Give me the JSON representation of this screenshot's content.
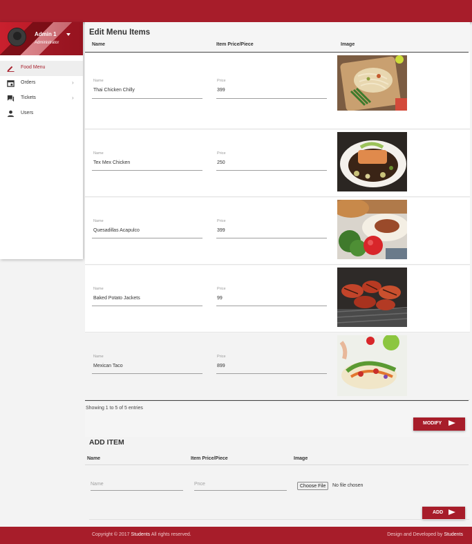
{
  "sidebar": {
    "user": {
      "name": "Admin 1",
      "role": "Administrator"
    },
    "items": [
      {
        "label": "Food Menu",
        "icon": "pencil-icon",
        "active": true
      },
      {
        "label": "Orders",
        "icon": "calendar-icon",
        "has_submenu": true
      },
      {
        "label": "Tickets",
        "icon": "chat-icon",
        "has_submenu": true
      },
      {
        "label": "Users",
        "icon": "person-icon"
      }
    ]
  },
  "menu": {
    "title": "Edit Menu Items",
    "columns": [
      "Name",
      "Item Price/Piece",
      "Image"
    ],
    "field_labels": {
      "name": "Name",
      "price": "Price"
    },
    "items": [
      {
        "name": "Thai Chicken Chilly",
        "price": "399",
        "image": "noodles-on-board"
      },
      {
        "name": "Tex Mex Chicken",
        "price": "250",
        "image": "salmon-plate"
      },
      {
        "name": "Quesadillas Acapulco",
        "price": "399",
        "image": "burger-and-tomato"
      },
      {
        "name": "Baked Potato Jackets",
        "price": "99",
        "image": "grilled-meat"
      },
      {
        "name": "Mexican Taco",
        "price": "899",
        "image": "taco-salad"
      }
    ],
    "entries_info": "Showing 1 to 5 of 5 entries",
    "modify_label": "MODIFY"
  },
  "add_item": {
    "title": "ADD ITEM",
    "columns": [
      "Name",
      "Item Price/Piece",
      "Image"
    ],
    "name_placeholder": "Name",
    "price_placeholder": "Price",
    "file_button": "Choose File",
    "file_status": "No file chosen",
    "add_label": "ADD"
  },
  "footer": {
    "copyright_prefix": "Copyright © 2017",
    "brand": "Students",
    "copyright_suffix": "All rights reserved.",
    "credit_prefix": "Design and Developed by",
    "credit_brand": "Students"
  },
  "colors": {
    "primary": "#a71d2a",
    "background": "#f3f3f3"
  }
}
